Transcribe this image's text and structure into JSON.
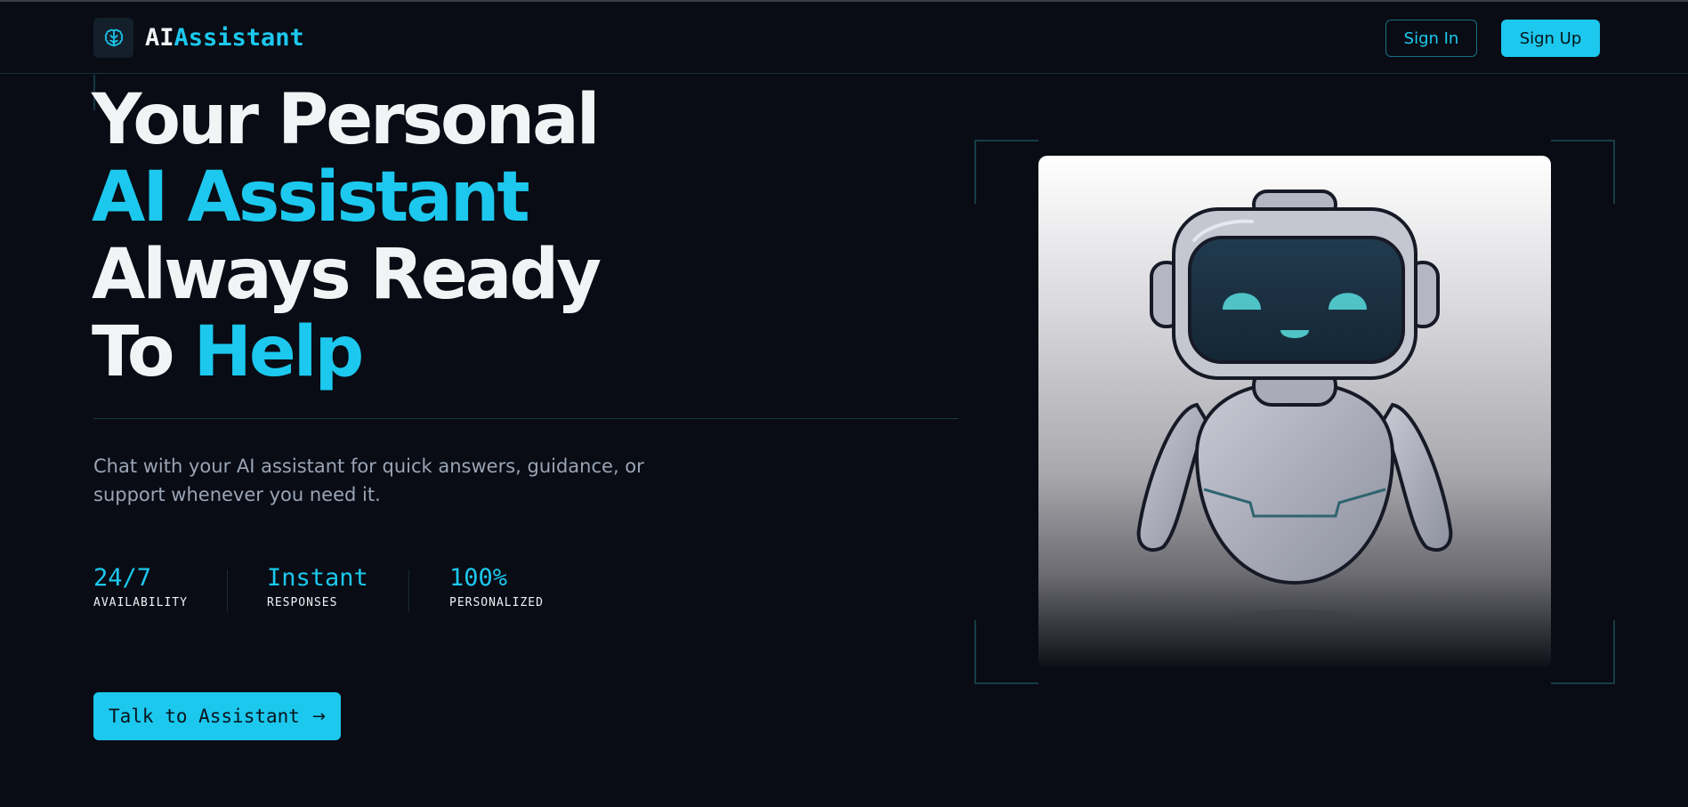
{
  "header": {
    "logo": {
      "part1": "AI",
      "part2": "Assistant",
      "icon": "brain-icon"
    },
    "sign_in_label": "Sign In",
    "sign_up_label": "Sign Up"
  },
  "hero": {
    "title": {
      "line1": "Your Personal",
      "line2": "AI Assistant",
      "line3": "Always Ready",
      "line4_prefix": "To ",
      "line4_highlight": "Help"
    },
    "description": "Chat with your AI assistant for quick answers, guidance, or support whenever you need it.",
    "stats": [
      {
        "value": "24/7",
        "label": "AVAILABILITY"
      },
      {
        "value": "Instant",
        "label": "RESPONSES"
      },
      {
        "value": "100%",
        "label": "PERSONALIZED"
      }
    ],
    "cta_label": "Talk to Assistant",
    "cta_icon": "arrow-right-icon"
  },
  "illustration": {
    "subject": "robot-illustration"
  },
  "colors": {
    "background": "#090c14",
    "accent": "#1cc8ee",
    "text": "#f1f3f5",
    "muted": "#9aa4b5"
  }
}
